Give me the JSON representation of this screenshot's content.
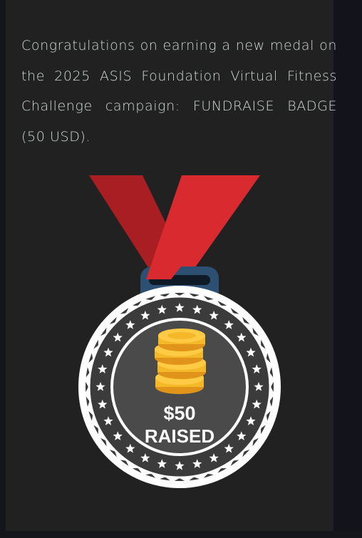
{
  "message": {
    "text": "Congratulations on earning a new medal on the 2025 ASIS Foundation Virtual Fitness Challenge campaign: FUNDRAISE BADGE (50 USD)."
  },
  "medal": {
    "icon": "dollar-coin-stack-icon",
    "amount": "$50",
    "caption": "RAISED",
    "colors": {
      "ribbon_dark": "#a91e22",
      "ribbon_light": "#d92a2f",
      "clasp": "#2c4f72",
      "outer_ring": "#ffffff",
      "ring_band": "#3b3b3b",
      "inner_disc": "#4a4a4a",
      "coin": "#f5b829",
      "coin_edge": "#e0951a"
    }
  }
}
